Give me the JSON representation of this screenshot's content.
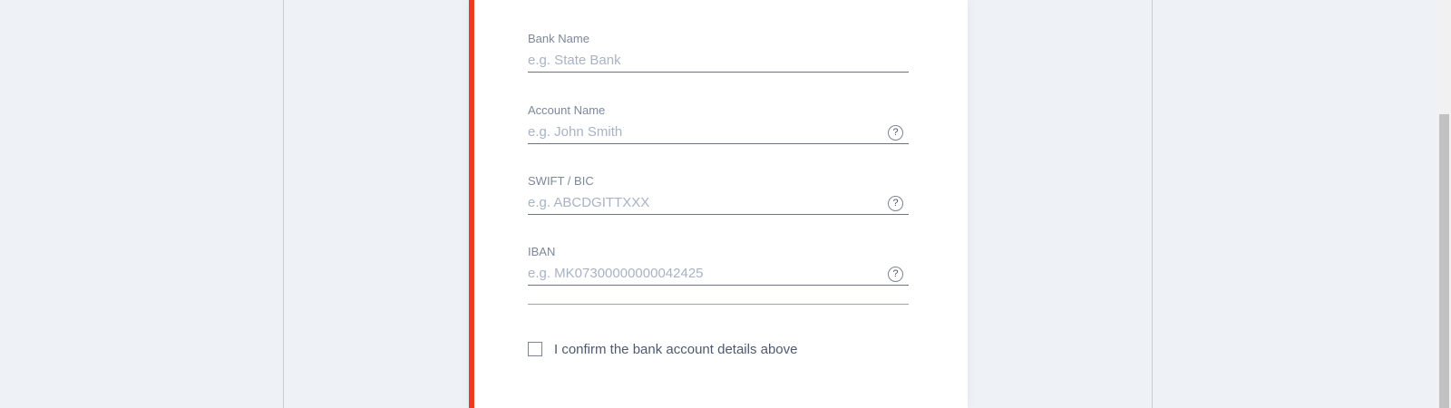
{
  "form": {
    "bank_name": {
      "label": "Bank Name",
      "placeholder": "e.g. State Bank",
      "value": ""
    },
    "account_name": {
      "label": "Account Name",
      "placeholder": "e.g. John Smith",
      "value": "",
      "help": "?"
    },
    "swift_bic": {
      "label": "SWIFT / BIC",
      "placeholder": "e.g. ABCDGITTXXX",
      "value": "",
      "help": "?"
    },
    "iban": {
      "label": "IBAN",
      "placeholder": "e.g. MK07300000000042425",
      "value": "",
      "help": "?"
    },
    "confirm": {
      "label": "I confirm the bank account details above",
      "checked": false
    }
  },
  "colors": {
    "accent": "#ee3a1e",
    "page_background": "#eef1f6",
    "card_background": "#ffffff",
    "label_text": "#7d8899",
    "placeholder_text": "#a8b3c3"
  }
}
